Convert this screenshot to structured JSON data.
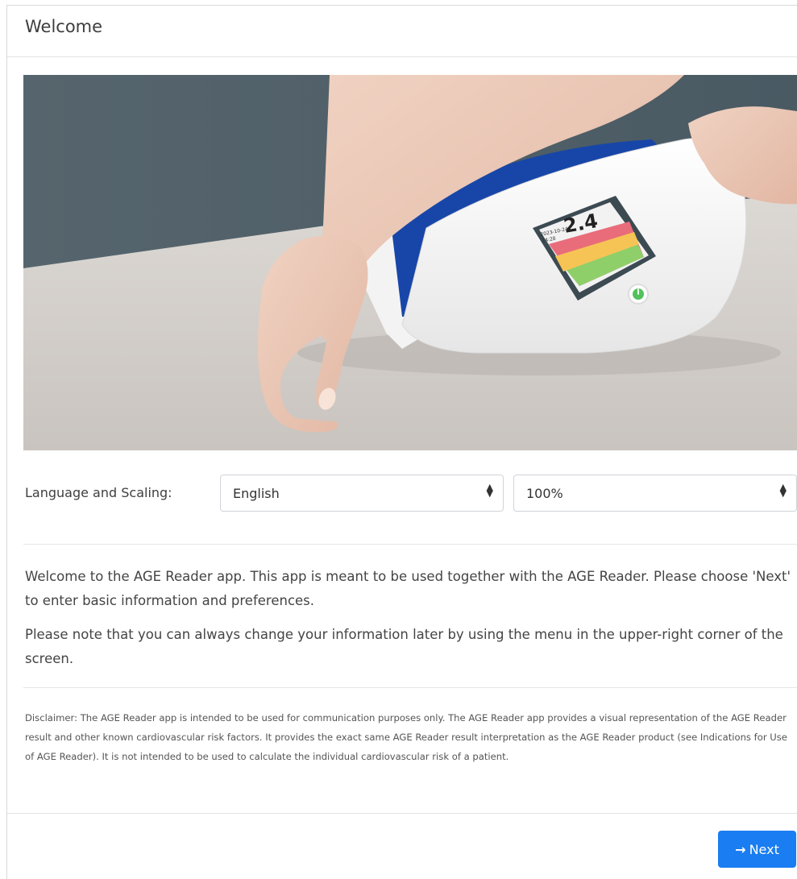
{
  "header": {
    "title": "Welcome"
  },
  "language": {
    "label": "Language and Scaling:",
    "language_value": "English",
    "scaling_value": "100%"
  },
  "device_display": {
    "reading": "2.4",
    "date_line1": "2023-10-24",
    "date_line2": "14:28"
  },
  "intro": {
    "paragraph1": "Welcome to the AGE Reader app. This app is meant to be used together with the AGE Reader. Please choose 'Next' to enter basic information and preferences.",
    "paragraph2": "Please note that you can always change your information later by using the menu in the upper-right corner of the screen."
  },
  "disclaimer": "Disclaimer: The AGE Reader app is intended to be used for communication purposes only. The AGE Reader app provides a visual representation of the AGE Reader result and other known cardiovascular risk factors. It provides the exact same AGE Reader result interpretation as the AGE Reader product (see Indications for Use of AGE Reader). It is not intended to be used to calculate the individual cardiovascular risk of a patient.",
  "footer": {
    "next_label": "Next"
  },
  "colors": {
    "primary": "#1a7df1",
    "device_blue": "#1846a8",
    "backdrop": "#4f5f68",
    "table": "#d3cfcb"
  },
  "icons": {
    "select_caret": "sort-caret-icon",
    "next_arrow": "arrow-right-icon",
    "power": "power-icon"
  }
}
